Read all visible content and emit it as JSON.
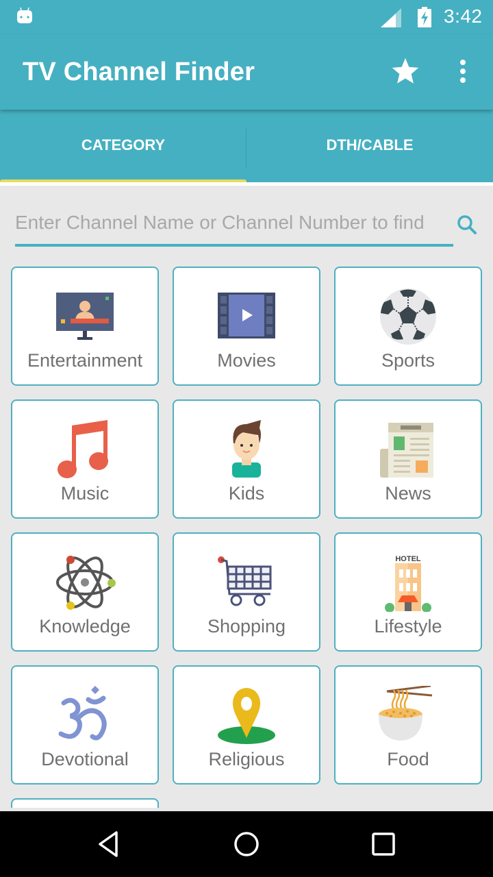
{
  "status_bar": {
    "time": "3:42",
    "icons": [
      "android-notification-icon",
      "cell-signal-icon",
      "battery-charging-icon"
    ]
  },
  "app_bar": {
    "title": "TV Channel Finder",
    "actions": [
      "star-icon",
      "more-vert-icon"
    ]
  },
  "tabs": [
    {
      "label": "CATEGORY",
      "selected": true
    },
    {
      "label": "DTH/CABLE",
      "selected": false
    }
  ],
  "search": {
    "placeholder": "Enter Channel Name or Channel Number to find",
    "value": "",
    "icon": "search-icon"
  },
  "categories": [
    {
      "label": "Entertainment",
      "icon": "tv-presenter-icon"
    },
    {
      "label": "Movies",
      "icon": "film-play-icon"
    },
    {
      "label": "Sports",
      "icon": "soccer-ball-icon"
    },
    {
      "label": "Music",
      "icon": "music-note-icon"
    },
    {
      "label": "Kids",
      "icon": "boy-icon"
    },
    {
      "label": "News",
      "icon": "newspaper-icon"
    },
    {
      "label": "Knowledge",
      "icon": "atom-icon"
    },
    {
      "label": "Shopping",
      "icon": "shopping-cart-icon"
    },
    {
      "label": "Lifestyle",
      "icon": "hotel-icon",
      "icon_text": "HOTEL"
    },
    {
      "label": "Devotional",
      "icon": "om-icon"
    },
    {
      "label": "Religious",
      "icon": "location-pin-icon"
    },
    {
      "label": "Food",
      "icon": "noodle-bowl-icon"
    }
  ],
  "colors": {
    "primary": "#45b0c1",
    "tab_indicator": "#eadb5c",
    "card_border": "#4fb0c0",
    "label_text": "#707070"
  },
  "nav_bar": [
    "back-button",
    "home-button",
    "recents-button"
  ]
}
